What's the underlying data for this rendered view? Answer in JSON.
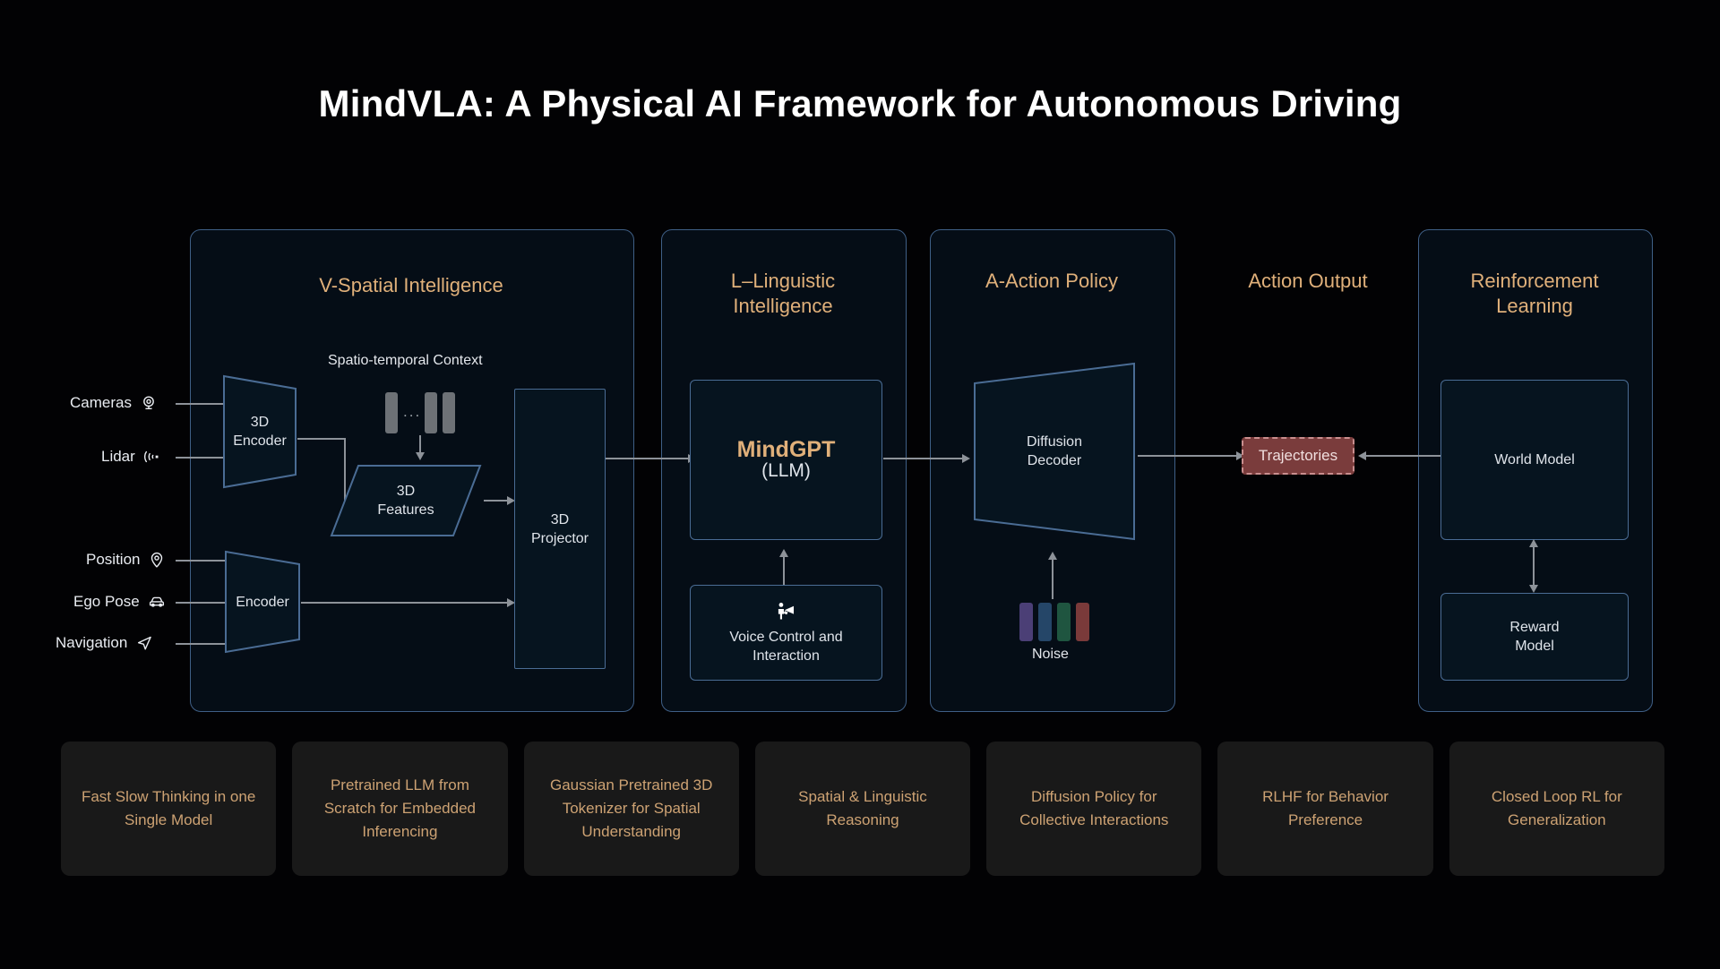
{
  "title": "MindVLA: A Physical AI Framework for Autonomous Driving",
  "panels": {
    "v_spatial": "V-Spatial Intelligence",
    "l_linguistic": "L–Linguistic\nIntelligence",
    "l_linguistic_line1": "L–Linguistic",
    "l_linguistic_line2": "Intelligence",
    "a_action": "A-Action Policy",
    "action_output": "Action Output",
    "rl_line1": "Reinforcement",
    "rl_line2": "Learning"
  },
  "inputs": [
    {
      "label": "Cameras",
      "icon": "camera-icon"
    },
    {
      "label": "Lidar",
      "icon": "lidar-icon"
    },
    {
      "label": "Position",
      "icon": "map-pin-icon"
    },
    {
      "label": "Ego Pose",
      "icon": "car-icon"
    },
    {
      "label": "Navigation",
      "icon": "navigation-arrow-icon"
    }
  ],
  "nodes": {
    "encoder_3d_line1": "3D",
    "encoder_3d_line2": "Encoder",
    "encoder": "Encoder",
    "features_line1": "3D",
    "features_line2": "Features",
    "projector_line1": "3D",
    "projector_line2": "Projector",
    "spatio_temporal_context": "Spatio-temporal Context",
    "context_dots": "...",
    "mindgpt": "MindGPT",
    "mindgpt_sub": "(LLM)",
    "voice_line1": "Voice Control and",
    "voice_line2": "Interaction",
    "voice_icon": "megaphone-person-icon",
    "diffusion_line1": "Diffusion",
    "diffusion_line2": "Decoder",
    "noise": "Noise",
    "trajectories": "Trajectories",
    "world_model": "World Model",
    "reward_line1": "Reward",
    "reward_line2": "Model"
  },
  "noise_colors": [
    "#4b3f76",
    "#254668",
    "#1f5540",
    "#7a3a3a"
  ],
  "colors": {
    "background": "#020204",
    "panel_border": "#3f5f86",
    "panel_fill": "#050d16",
    "node_border": "#4a6c94",
    "node_fill": "#06141f",
    "accent_gold": "#e0b07a",
    "card_text": "#cda273",
    "card_bg": "#191919",
    "arrow": "#8d9299",
    "trajectory_fill": "#7a3c3c",
    "trajectory_border": "#c98e8e"
  },
  "cards": [
    "Fast Slow Thinking in one Single Model",
    "Pretrained LLM from Scratch for Embedded Inferencing",
    "Gaussian Pretrained 3D Tokenizer for Spatial Understanding",
    "Spatial & Linguistic Reasoning",
    "Diffusion Policy for Collective Interactions",
    "RLHF for Behavior Preference",
    "Closed Loop RL for Generalization"
  ]
}
